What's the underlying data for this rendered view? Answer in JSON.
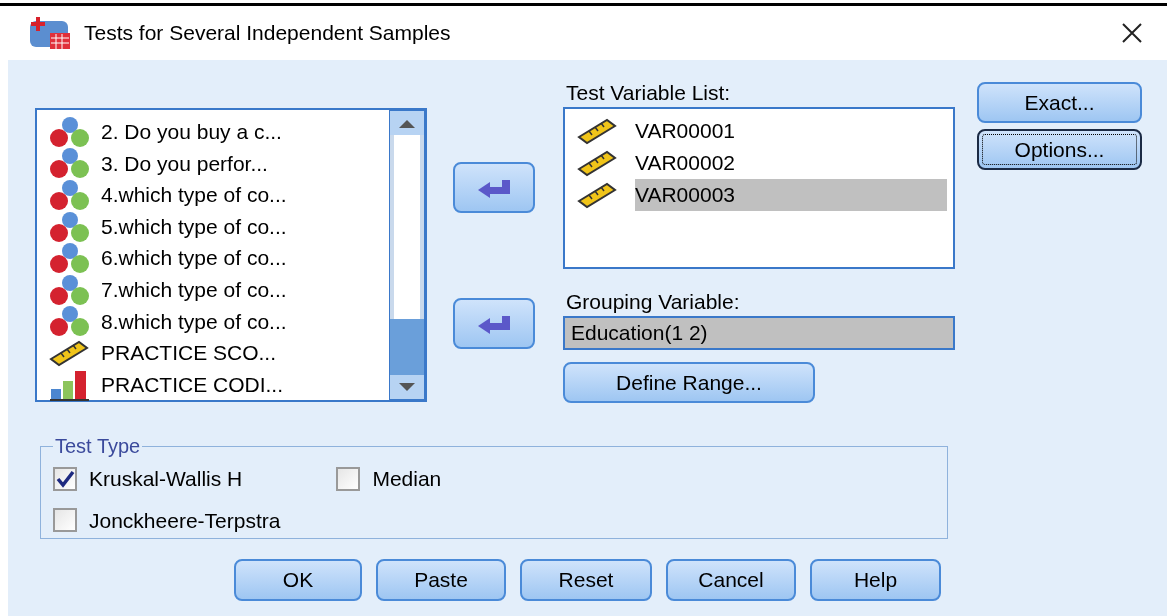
{
  "window": {
    "title": "Tests for Several Independent Samples"
  },
  "source_list": {
    "items": [
      {
        "label": "2. Do you buy a c...",
        "kind": "nominal"
      },
      {
        "label": "3. Do you perfor...",
        "kind": "nominal"
      },
      {
        "label": "4.which type of co...",
        "kind": "nominal"
      },
      {
        "label": "5.which type of co...",
        "kind": "nominal"
      },
      {
        "label": "6.which type of co...",
        "kind": "nominal"
      },
      {
        "label": "7.which type of co...",
        "kind": "nominal"
      },
      {
        "label": "8.which type of co...",
        "kind": "nominal"
      },
      {
        "label": "PRACTICE SCO...",
        "kind": "scale"
      },
      {
        "label": "PRACTICE CODI...",
        "kind": "ordinal"
      }
    ]
  },
  "test_variable_list": {
    "label": "Test Variable List:",
    "items": [
      {
        "label": "VAR00001",
        "kind": "scale",
        "selected": false
      },
      {
        "label": "VAR00002",
        "kind": "scale",
        "selected": false
      },
      {
        "label": "VAR00003",
        "kind": "scale",
        "selected": true
      }
    ]
  },
  "grouping_variable": {
    "label": "Grouping Variable:",
    "value": "Education(1 2)"
  },
  "define_range_button": "Define Range...",
  "side_buttons": [
    {
      "label": "Exact...",
      "focused": false
    },
    {
      "label": "Options...",
      "focused": true
    }
  ],
  "test_type": {
    "title": "Test Type",
    "options": [
      {
        "label": "Kruskal-Wallis H",
        "checked": true
      },
      {
        "label": "Median",
        "checked": false
      },
      {
        "label": "Jonckheere-Terpstra",
        "checked": false
      }
    ]
  },
  "buttons": [
    "OK",
    "Paste",
    "Reset",
    "Cancel",
    "Help"
  ]
}
